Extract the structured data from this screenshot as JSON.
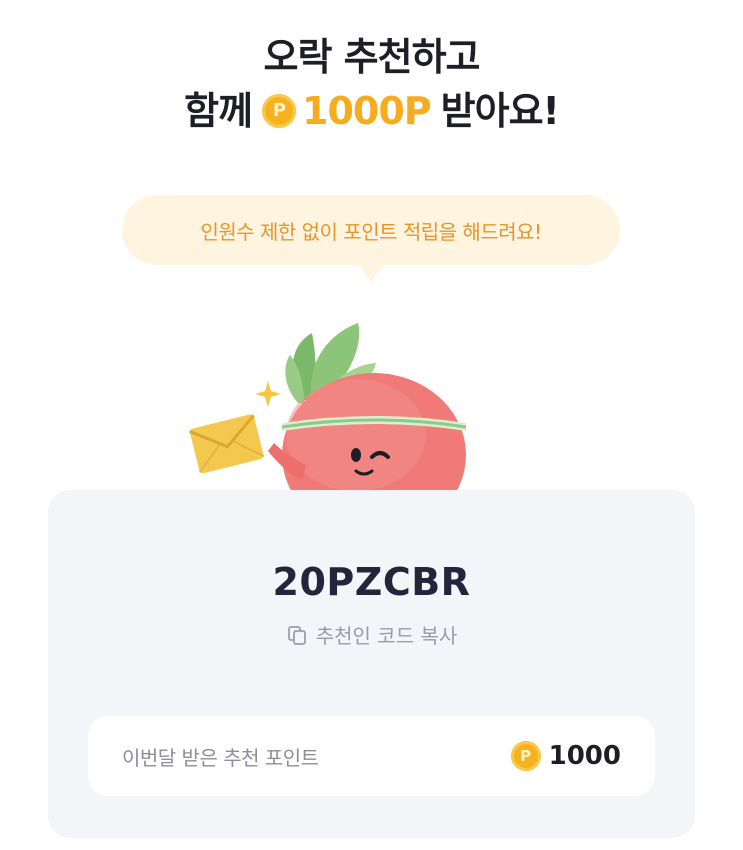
{
  "headline": {
    "line1": "오락 추천하고",
    "line2_prefix": "함께",
    "coin_symbol": "P",
    "amount": "1000P",
    "line2_suffix": "받아요!"
  },
  "bubble": {
    "text": "인원수 제한 없이 포인트 적립을 해드려요!"
  },
  "referral": {
    "code": "20PZCBR",
    "copy_label": "추천인 코드 복사"
  },
  "points": {
    "label": "이번달 받은 추천 포인트",
    "coin_symbol": "P",
    "value": "1000"
  },
  "colors": {
    "accent": "#f5ad1f",
    "bubble_bg": "#fff4e0",
    "bubble_text": "#e6952a",
    "card_bg": "#f4f5f9"
  },
  "icons": {
    "coin": "point-coin-icon",
    "copy": "copy-icon",
    "mascot": "radish-mascot-illustration"
  }
}
